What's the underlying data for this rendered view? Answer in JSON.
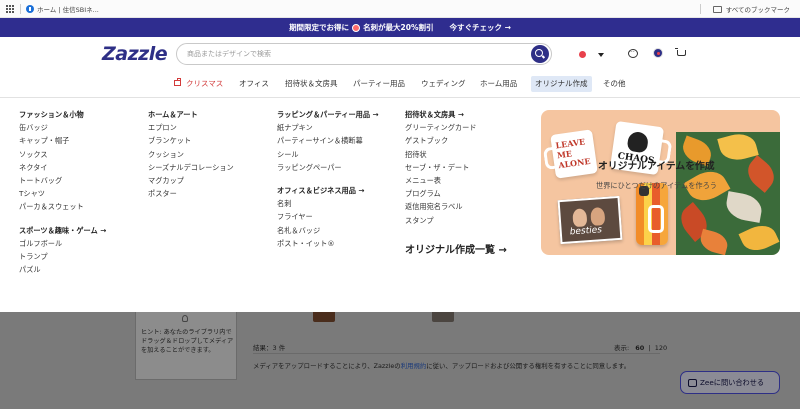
{
  "bookmarks": {
    "item_label": "ホーム | 住信SBIネ...",
    "all_bookmarks": "すべてのブックマーク"
  },
  "promo": {
    "text_left": "期間限定でお得に",
    "text_right": "名刺が最大20%割引",
    "cta": "今すぐチェック →"
  },
  "header": {
    "logo": "Zazzle",
    "search_placeholder": "商品またはデザインで検索"
  },
  "nav": {
    "items": [
      "クリスマス",
      "オフィス",
      "招待状＆文房具",
      "パーティー用品",
      "ウェディング",
      "ホーム用品",
      "オリジナル作成",
      "その他"
    ]
  },
  "menu": {
    "col1": {
      "heading": "ファッション＆小物",
      "items": [
        "缶バッジ",
        "キャップ・帽子",
        "ソックス",
        "ネクタイ",
        "トートバッグ",
        "Tシャツ",
        "パーカ＆スウェット"
      ],
      "heading2": "スポーツ＆趣味・ゲーム →",
      "items2": [
        "ゴルフボール",
        "トランプ",
        "パズル"
      ]
    },
    "col2": {
      "heading": "ホーム＆アート",
      "items": [
        "エプロン",
        "ブランケット",
        "クッション",
        "シーズナルデコレーション",
        "マグカップ",
        "ポスター"
      ]
    },
    "col3": {
      "heading": "ラッピング＆パーティー用品 →",
      "items": [
        "紙ナプキン",
        "パーティーサイン＆横断幕",
        "シール",
        "ラッピングペーパー"
      ],
      "heading2": "オフィス＆ビジネス用品 →",
      "items2": [
        "名刺",
        "フライヤー",
        "名札＆バッジ",
        "ポスト・イット®"
      ]
    },
    "col4": {
      "heading": "招待状＆文房具 →",
      "items": [
        "グリーティングカード",
        "ゲストブック",
        "招待状",
        "セーブ・ザ・デート",
        "メニュー表",
        "プログラム",
        "返信用宛名ラベル",
        "スタンプ"
      ]
    },
    "all_link": "オリジナル作成一覧 →",
    "promo_title": "オリジナルアイテムを作成",
    "promo_sub": "世界にひとつだけのアイテムを作ろう",
    "art_text": {
      "mug1": "LEAVE ME ALONE",
      "mug2": "CHAOS",
      "photo": "besties"
    }
  },
  "background": {
    "hint": "ヒント: あなたのライブラリ内でドラッグ＆ドロップしてメディアを加えることができます。",
    "results": "結果：3 件",
    "display_label": "表示:",
    "display_60": "60",
    "display_sep": "|",
    "display_120": "120",
    "consent_pre": "メディアをアップロードすることにより、Zazzleの",
    "consent_link": "利用規約",
    "consent_post": "に従い、アップロードおよび公開する権利を有することに同意します。",
    "zee": "Zeeに問い合わせる"
  },
  "colors": {
    "brand": "#2e2f86",
    "promo_bg": "#2f2d8f",
    "xmas": "#d23a3a",
    "active_nav_bg": "#dfe8f6"
  }
}
